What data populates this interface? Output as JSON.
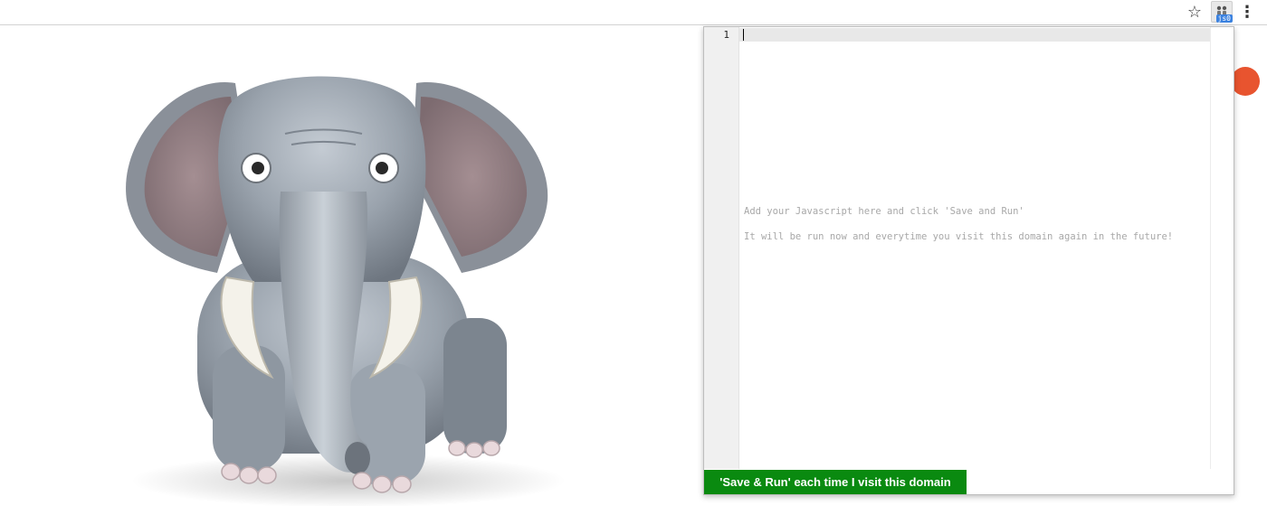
{
  "toolbar": {
    "star_glyph": "☆",
    "extension_badge": "js0",
    "menu_glyph": "⋮"
  },
  "popup": {
    "line_number": "1",
    "placeholder_line_1": "Add your Javascript here and click 'Save and Run'",
    "placeholder_line_2": "It will be run now and everytime you visit this domain again in the future!",
    "save_button_label": "'Save & Run' each time I visit this domain"
  },
  "colors": {
    "save_button": "#0a8a10",
    "page_accent": "#e8542f",
    "extension_badge": "#3b82e0"
  },
  "icons": [
    "bookmark-star-icon",
    "extension-icon",
    "menu-icon"
  ]
}
